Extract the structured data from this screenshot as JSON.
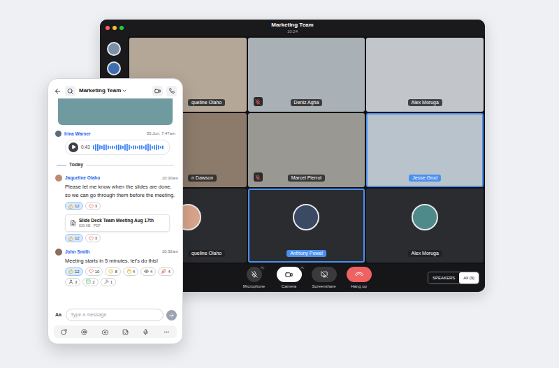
{
  "window": {
    "title": "Marketing Team",
    "time": "10:24"
  },
  "tiles": [
    {
      "name": "queline Olaho",
      "kind": "video",
      "muted": false,
      "highlighted": false
    },
    {
      "name": "Deniz Agha",
      "kind": "video",
      "muted": true,
      "highlighted": false
    },
    {
      "name": "Alex Moruga",
      "kind": "video",
      "muted": false,
      "highlighted": false
    },
    {
      "name": "n Dawson",
      "kind": "video",
      "muted": false,
      "highlighted": false
    },
    {
      "name": "Marcel Pierrot",
      "kind": "video",
      "muted": true,
      "highlighted": false
    },
    {
      "name": "Jesse Grod",
      "kind": "video",
      "muted": false,
      "highlighted": true
    },
    {
      "name": "queline Olaho",
      "kind": "avatar",
      "muted": false,
      "highlighted": false
    },
    {
      "name": "Anthony Powel",
      "kind": "avatar",
      "muted": false,
      "highlighted": true
    },
    {
      "name": "Alex Moruga",
      "kind": "avatar",
      "muted": false,
      "highlighted": false
    }
  ],
  "controls": [
    {
      "label": "Microphone",
      "kind": "microphone",
      "on": false,
      "menu": true
    },
    {
      "label": "Camera",
      "kind": "camera",
      "on": true,
      "menu": true
    },
    {
      "label": "Screenshare",
      "kind": "screenshare",
      "on": false,
      "menu": false
    },
    {
      "label": "Hang up",
      "kind": "hangup",
      "on": false,
      "menu": false
    }
  ],
  "view_toggle": [
    {
      "label": "SPEAKERS",
      "selected": false
    },
    {
      "label": "All (9)",
      "selected": true
    }
  ],
  "chat": {
    "title": "Marketing Team",
    "voice": {
      "author": "Irina Warner",
      "time": "30.Jun, 7:47am",
      "duration": "0:43"
    },
    "divider": "Today",
    "messages": [
      {
        "author": "Jaqueline Olaho",
        "time": "10:30am",
        "text": "Please let me know when the slides are done, so we can go through them before the meeting.",
        "reactions": [
          {
            "kind": "thumbs-up",
            "count": "12",
            "selected": true
          },
          {
            "kind": "heart",
            "count": "3",
            "selected": false
          }
        ],
        "attachment": {
          "title": "Slide Deck Team Meeting Aug 17th",
          "meta": "830 KB · PDF"
        },
        "attachment_reactions": [
          {
            "kind": "thumbs-up",
            "count": "12",
            "selected": true
          },
          {
            "kind": "heart",
            "count": "3",
            "selected": false
          }
        ]
      },
      {
        "author": "John Smith",
        "time": "10:32am",
        "text": "Meeting starts in 5 minutes, let's do this!",
        "reactions": [
          {
            "kind": "thumbs-up",
            "count": "12",
            "selected": true
          },
          {
            "kind": "heart",
            "count": "10",
            "selected": false
          },
          {
            "kind": "smile",
            "count": "8",
            "selected": false
          },
          {
            "kind": "hand",
            "count": "4",
            "selected": false
          },
          {
            "kind": "eyes",
            "count": "4",
            "selected": false
          },
          {
            "kind": "party",
            "count": "4",
            "selected": false
          },
          {
            "kind": "person",
            "count": "3",
            "selected": false
          },
          {
            "kind": "check",
            "count": "2",
            "selected": false
          },
          {
            "kind": "hammer",
            "count": "1",
            "selected": false
          }
        ],
        "attachment": null,
        "attachment_reactions": []
      }
    ],
    "composer": {
      "format_label": "Aa",
      "placeholder": "Type a message"
    }
  }
}
